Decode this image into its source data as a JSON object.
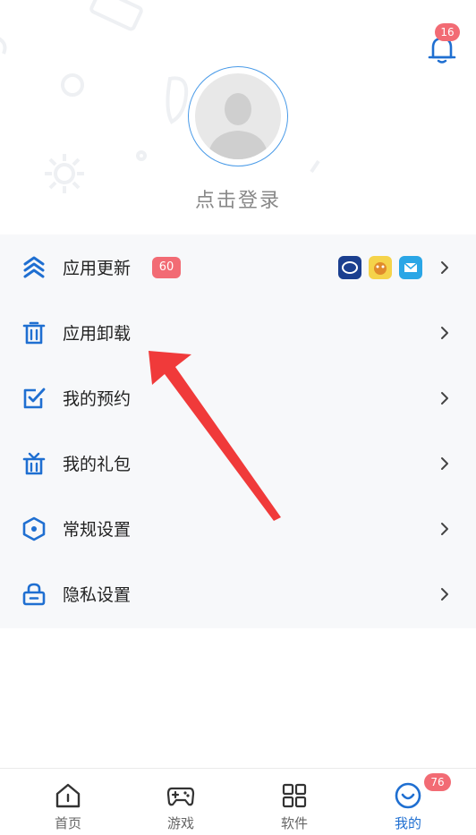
{
  "profile": {
    "login_label": "点击登录"
  },
  "notifications": {
    "badge": "16"
  },
  "menu": {
    "items": [
      {
        "key": "update",
        "label": "应用更新",
        "badge": "60",
        "icon": "layers-icon"
      },
      {
        "key": "uninstall",
        "label": "应用卸载",
        "icon": "trash-icon"
      },
      {
        "key": "booking",
        "label": "我的预约",
        "icon": "check-square-icon"
      },
      {
        "key": "gift",
        "label": "我的礼包",
        "icon": "gift-icon"
      },
      {
        "key": "settings",
        "label": "常规设置",
        "icon": "hexagon-icon"
      },
      {
        "key": "privacy",
        "label": "隐私设置",
        "icon": "lock-icon"
      }
    ]
  },
  "tabs": [
    {
      "label": "首页",
      "icon": "home-icon"
    },
    {
      "label": "游戏",
      "icon": "gamepad-icon"
    },
    {
      "label": "软件",
      "icon": "grid-icon"
    },
    {
      "label": "我的",
      "icon": "smile-icon",
      "active": true,
      "badge": "76"
    }
  ],
  "colors": {
    "accent": "#1f6fd1",
    "badge": "#f26b74",
    "annotation_arrow": "#f03a3a"
  }
}
